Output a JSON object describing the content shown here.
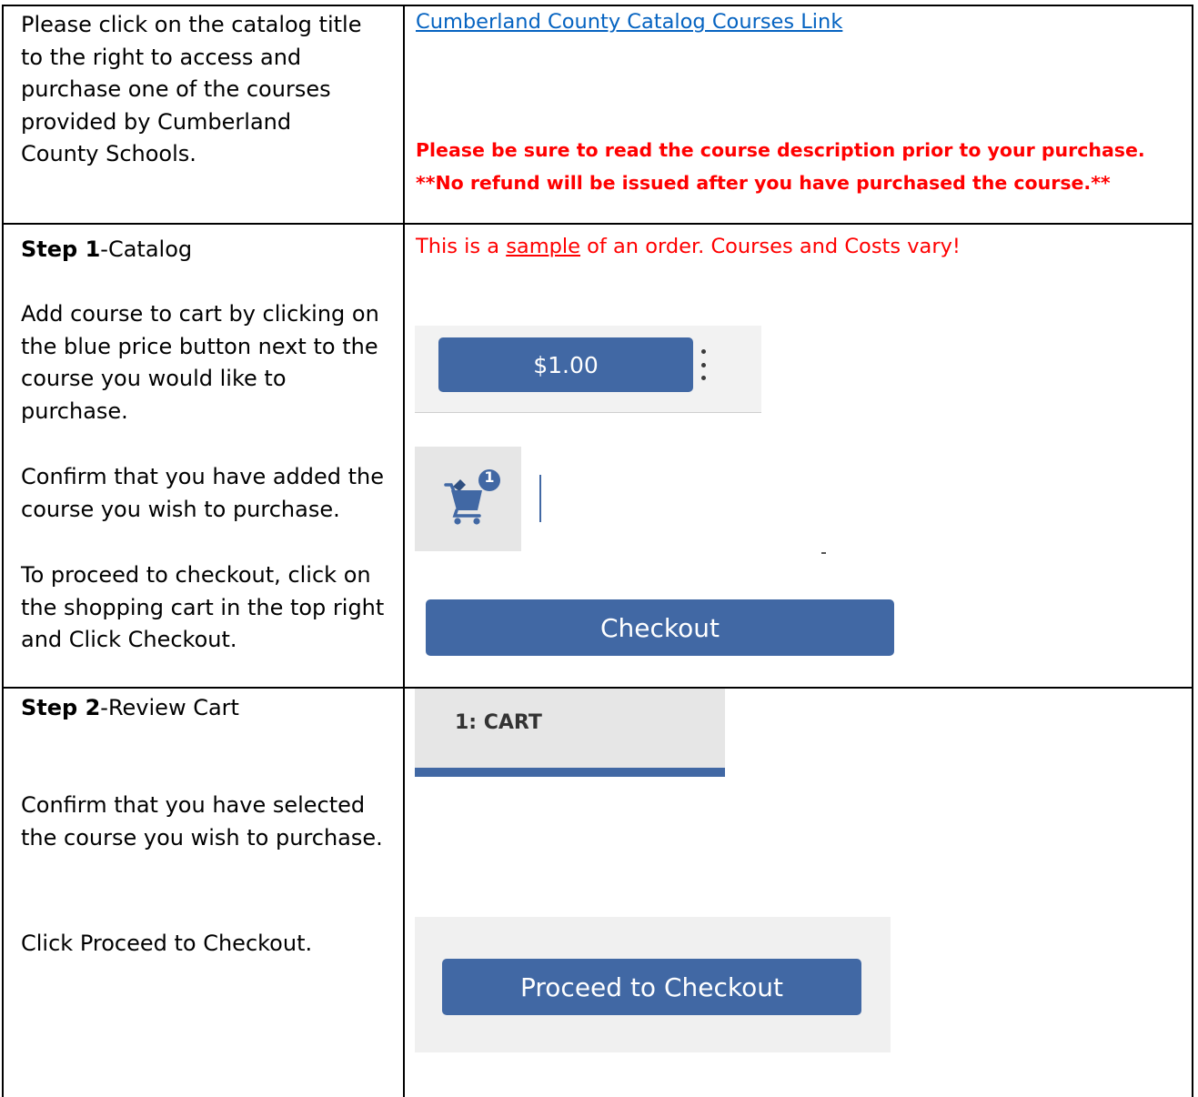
{
  "row1": {
    "left_text": [
      "Please click on the catalog title",
      "to the right to access and",
      "purchase one of the courses",
      "provided by Cumberland",
      "County Schools."
    ],
    "link_text": "Cumberland County Catalog Courses Link",
    "warning_lines": [
      "Please be sure to read the course description prior to your purchase.",
      "**No refund will be issued after you have purchased the course.**"
    ]
  },
  "row2": {
    "step_bold": "Step 1",
    "step_rest": "-Catalog",
    "para1": [
      "Add course to cart by clicking on",
      "the blue price button next to the",
      "course you would like to",
      "purchase."
    ],
    "para2": [
      "Confirm that you have added the",
      "course you wish to purchase."
    ],
    "para3": [
      "To proceed to checkout, click on",
      "the shopping cart in the top right",
      "and Click Checkout."
    ],
    "note_pre": "This is a ",
    "note_underlined": "sample",
    "note_post": " of an order. Courses and Costs vary!",
    "price_label": "$1.00",
    "cart_badge": "1",
    "checkout_label": "Checkout",
    "colors": {
      "button_blue": "#4168a4",
      "warning_red": "#ff0000",
      "link_blue": "#0563c1"
    },
    "icons": [
      "kebab-menu-icon",
      "shopping-cart-icon"
    ]
  },
  "row3": {
    "step_bold": "Step 2",
    "step_rest": "-Review Cart",
    "para1": [
      "Confirm that you have selected",
      "the course you wish to purchase."
    ],
    "para2": "Click Proceed to Checkout.",
    "cart_tab_label": "1: CART",
    "proceed_label": "Proceed to Checkout"
  }
}
